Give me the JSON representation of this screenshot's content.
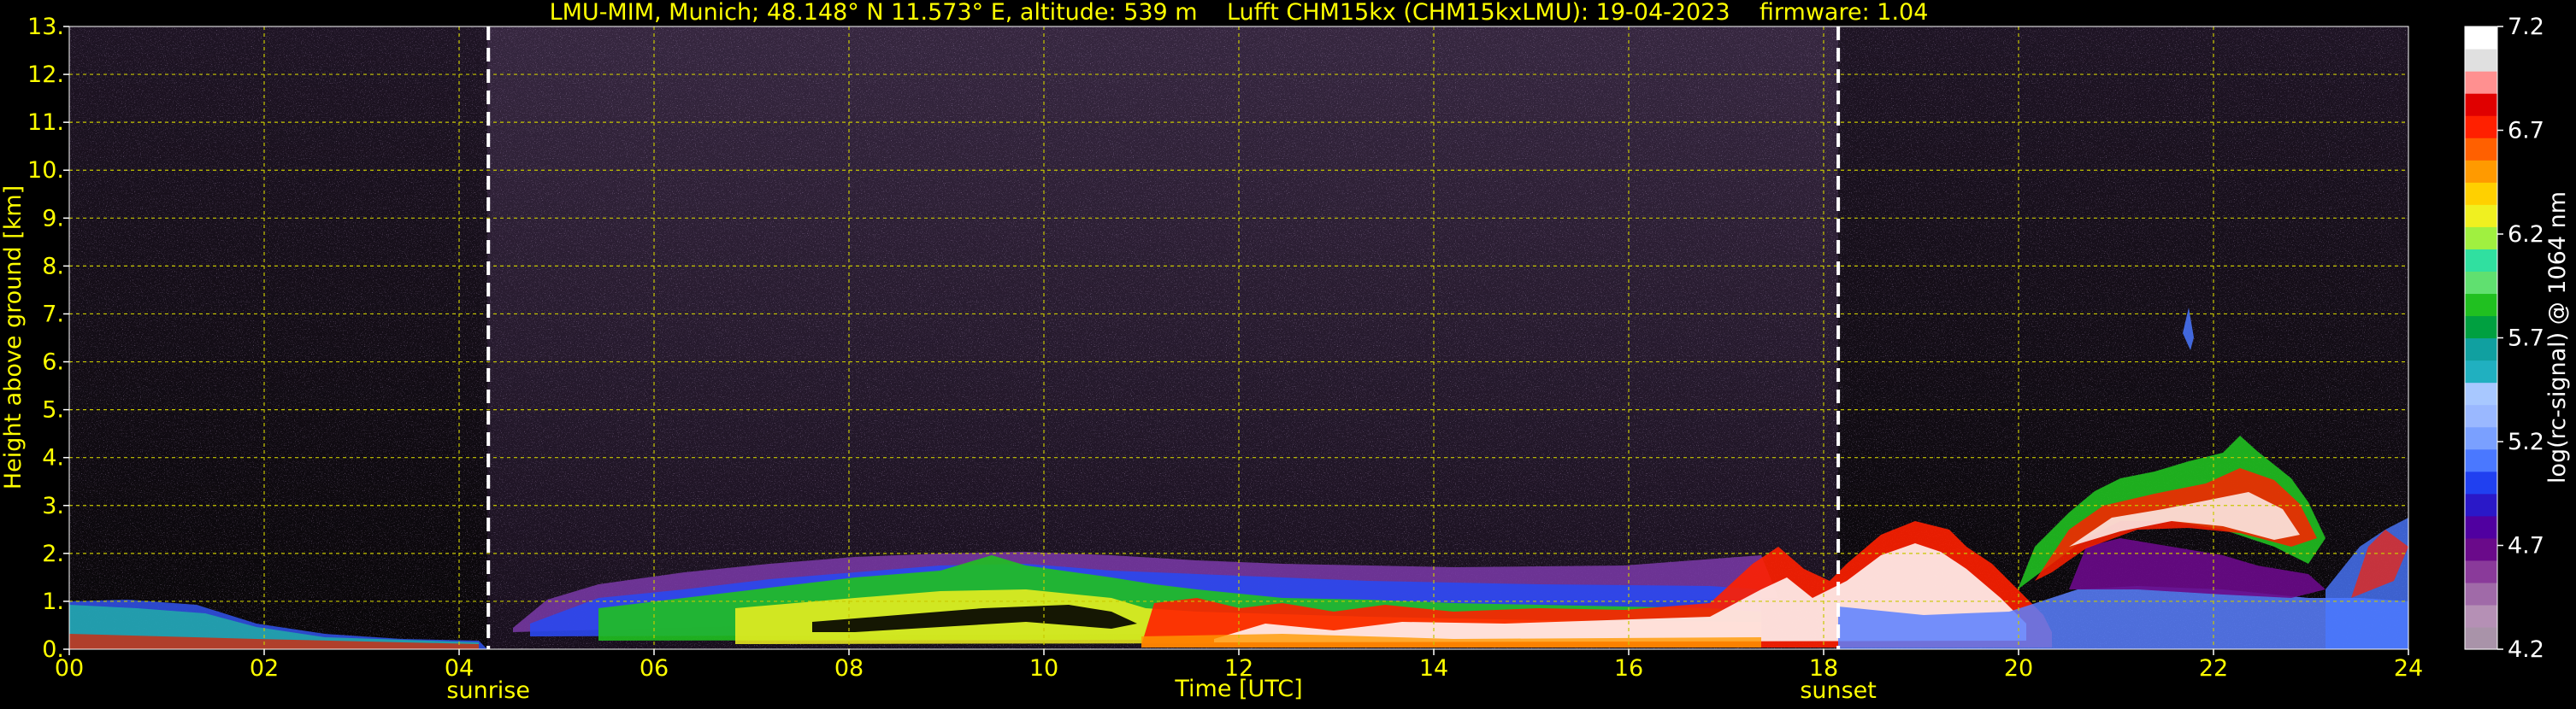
{
  "chart_data": {
    "type": "heatmap",
    "title": "LMU-MIM, Munich; 48.148° N 11.573° E, altitude: 539 m    Lufft CHM15kx (CHM15kxLMU): 19-04-2023    firmware: 1.04",
    "xlabel": "Time [UTC]",
    "ylabel": "Height above ground [km]",
    "xlim": [
      0,
      24
    ],
    "ylim": [
      0,
      13
    ],
    "x_ticks": [
      "00",
      "02",
      "04",
      "06",
      "08",
      "10",
      "12",
      "14",
      "16",
      "18",
      "20",
      "22",
      "24"
    ],
    "y_ticks": [
      "0.",
      "1.",
      "2.",
      "3.",
      "4.",
      "5.",
      "6.",
      "7.",
      "8.",
      "9.",
      "10.",
      "11.",
      "12.",
      "13."
    ],
    "grid": true,
    "colorbar": {
      "label": "log(rc-signal) @ 1064 nm",
      "range": [
        4.2,
        7.2
      ],
      "ticks": [
        "7.2",
        "6.7",
        "6.2",
        "5.7",
        "5.2",
        "4.7",
        "4.2"
      ],
      "colors": [
        "#a993a9",
        "#b590b5",
        "#a06aa8",
        "#8a3a9a",
        "#6a0a8a",
        "#5000a0",
        "#2a18c8",
        "#2040f0",
        "#4a78ff",
        "#7aa0ff",
        "#9ab8ff",
        "#a8c8ff",
        "#20b0c0",
        "#10a0a0",
        "#00a040",
        "#20c020",
        "#60e070",
        "#30e0a0",
        "#a0f040",
        "#f0f020",
        "#ffd000",
        "#ff9a00",
        "#ff6000",
        "#ff2000",
        "#e00000",
        "#ff9090",
        "#e0e0e0",
        "#ffffff"
      ]
    },
    "annotations": [
      {
        "text": "sunrise",
        "x": 4.3
      },
      {
        "text": "sunset",
        "x": 18.15
      }
    ],
    "colors": {
      "text": "#ffff00",
      "grid": "#c8c800",
      "background": "#000000"
    }
  }
}
